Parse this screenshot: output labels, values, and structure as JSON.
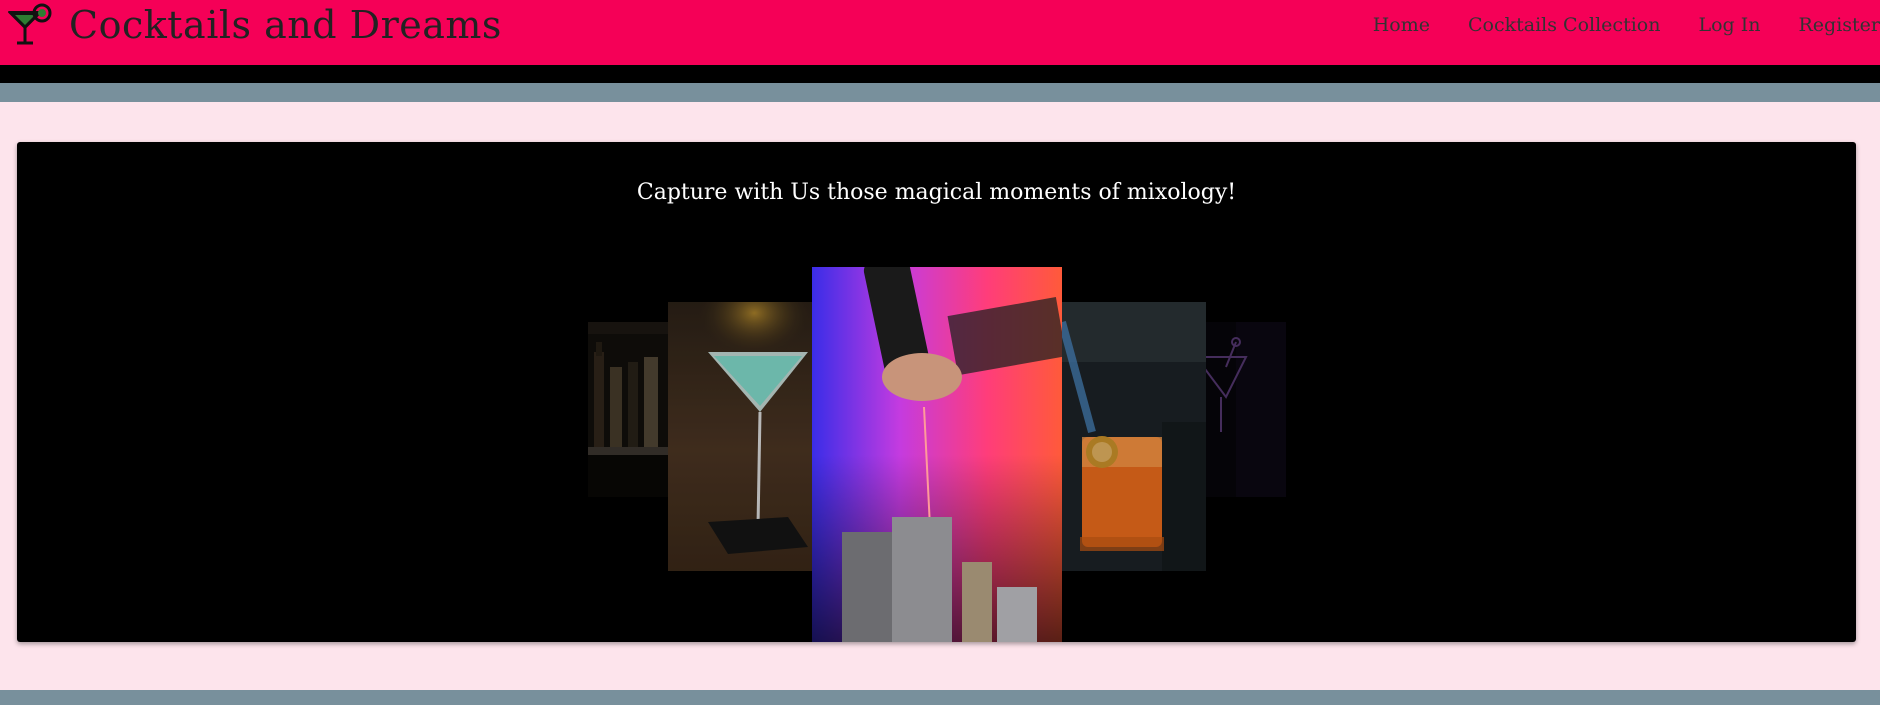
{
  "header": {
    "brand_title": "Cocktails and Dreams",
    "brand_icon": "cocktail-glass-icon",
    "nav": [
      {
        "label": "Home"
      },
      {
        "label": "Cocktails Collection"
      },
      {
        "label": "Log In"
      },
      {
        "label": "Register"
      }
    ]
  },
  "hero": {
    "tagline": "Capture with Us those magical moments of mixology!",
    "slides": [
      {
        "name": "bar-shelf-bottles-image"
      },
      {
        "name": "green-martini-image"
      },
      {
        "name": "bartender-pouring-image"
      },
      {
        "name": "orange-cocktail-image"
      },
      {
        "name": "neon-cocktail-sign-image"
      }
    ]
  },
  "colors": {
    "header": "#f50057",
    "page_background": "#fde4ec",
    "accent_bar": "#78909c",
    "card": "#000000"
  }
}
